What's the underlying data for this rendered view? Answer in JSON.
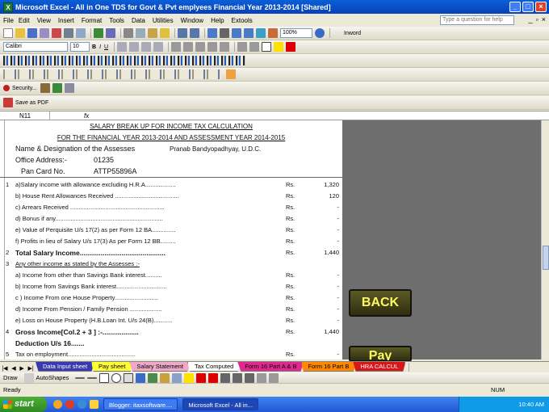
{
  "window": {
    "title": "Microsoft Excel - All in One  TDS for Govt & Pvt emplyees  Financial Year 2013-2014  [Shared]"
  },
  "menu": {
    "items": [
      "File",
      "Edit",
      "View",
      "Insert",
      "Format",
      "Tools",
      "Data",
      "Utilities",
      "Window",
      "Help",
      "Extools"
    ],
    "ask_placeholder": "Type a question for help"
  },
  "toolbar": {
    "zoom": "100%",
    "font_name": "Calibri",
    "font_size": "10",
    "iinword": "Inword",
    "security_label": "Security...",
    "save_pdf": "Save as PDF"
  },
  "formula_bar": {
    "cell_ref": "N11",
    "fx": "fx"
  },
  "sheet": {
    "title1": "SALARY BREAK UP FOR INCOME TAX CALCULATION",
    "title2": "FOR THE FINANCIAL YEAR 2013-2014 AND ASSESSMENT YEAR 2014-2015",
    "name_label": "Name & Designation of the Assesses",
    "name_value": "Pranab Bandyopadhyay, U.D.C.",
    "office_label": "Office Address:-",
    "office_value": "01235",
    "pan_label": "Pan Card No.",
    "pan_value": "ATTP55896A",
    "rows": [
      {
        "num": "1",
        "label": "a)Salary income with allowance excluding H.R.A..................",
        "rs": "Rs.",
        "value": "1,320"
      },
      {
        "num": "",
        "label": "b) House Rent Allowances Received ......................................",
        "rs": "Rs.",
        "value": "120"
      },
      {
        "num": "",
        "label": "c) Arrears Received ........................................................",
        "rs": "Rs.",
        "value": "-"
      },
      {
        "num": "",
        "label": "d) Bonus if any................................................................",
        "rs": "Rs.",
        "value": "-"
      },
      {
        "num": "",
        "label": "e) Value of Perquisite U/s 17(2) as per Form 12 BA..............",
        "rs": "Rs.",
        "value": "-"
      },
      {
        "num": "",
        "label": "f) Profits in lieu of Salary U/s 17(3) As per Form 12 BB.........",
        "rs": "Rs.",
        "value": "-"
      },
      {
        "num": "2",
        "label": "Total Salary Income.............................................",
        "rs": "Rs.",
        "value": "1,440",
        "bold": true
      },
      {
        "num": "3",
        "label": "Any other income as stated by the Assesses :-",
        "rs": "",
        "value": "",
        "underline": true
      },
      {
        "num": "",
        "label": "a) Income from other than Savings Bank interest..........",
        "rs": "Rs.",
        "value": "-"
      },
      {
        "num": "",
        "label": "b) Income  from Savings Bank interest..............................",
        "rs": "Rs.",
        "value": "-"
      },
      {
        "num": "",
        "label": "c ) Income From one House Property..........................",
        "rs": "Rs.",
        "value": "-"
      },
      {
        "num": "",
        "label": "d) Income From Pension / Family Pension ...................",
        "rs": "Rs.",
        "value": "-"
      },
      {
        "num": "",
        "label": "e) Loss on House Property (H.B.Loan Int. U/s 24(B)...........",
        "rs": "Rs.",
        "value": "-"
      },
      {
        "num": "4",
        "label": "Gross Income[Col.2 + 3 ] :-...................",
        "rs": "Rs.",
        "value": "1,440",
        "bold": true
      },
      {
        "num": "",
        "label": "Deduction U/s 16.......",
        "rs": "",
        "value": "",
        "bold": true
      },
      {
        "num": "5",
        "label": "Tax on employment........................................",
        "rs": "Rs.",
        "value": "-"
      }
    ]
  },
  "buttons": {
    "back": "BACK",
    "pay": "Pay"
  },
  "tabs": [
    {
      "label": "Data Input sheet",
      "color": "#3a3ab0",
      "text": "#ffffff"
    },
    {
      "label": "Pay sheet",
      "color": "#ffff33",
      "text": "#000000"
    },
    {
      "label": "Salary Statement",
      "color": "#f0a8c8",
      "text": "#000000"
    },
    {
      "label": "Tax Computed",
      "color": "#ffffff",
      "text": "#000000"
    },
    {
      "label": "Form 16 Part A & B",
      "color": "#e02890",
      "text": "#000000"
    },
    {
      "label": "Form 16 Part B",
      "color": "#ff8800",
      "text": "#000000"
    },
    {
      "label": "HRA CALCUL",
      "color": "#d81818",
      "text": "#ffffff"
    }
  ],
  "drawbar": {
    "draw": "Draw",
    "autoshapes": "AutoShapes"
  },
  "status": {
    "ready": "Ready",
    "num": "NUM"
  },
  "taskbar": {
    "start": "start",
    "tasks": [
      "Blogger: itaxsoftware....",
      "Microsoft Excel - All in..."
    ],
    "clock": "10:40 AM"
  }
}
